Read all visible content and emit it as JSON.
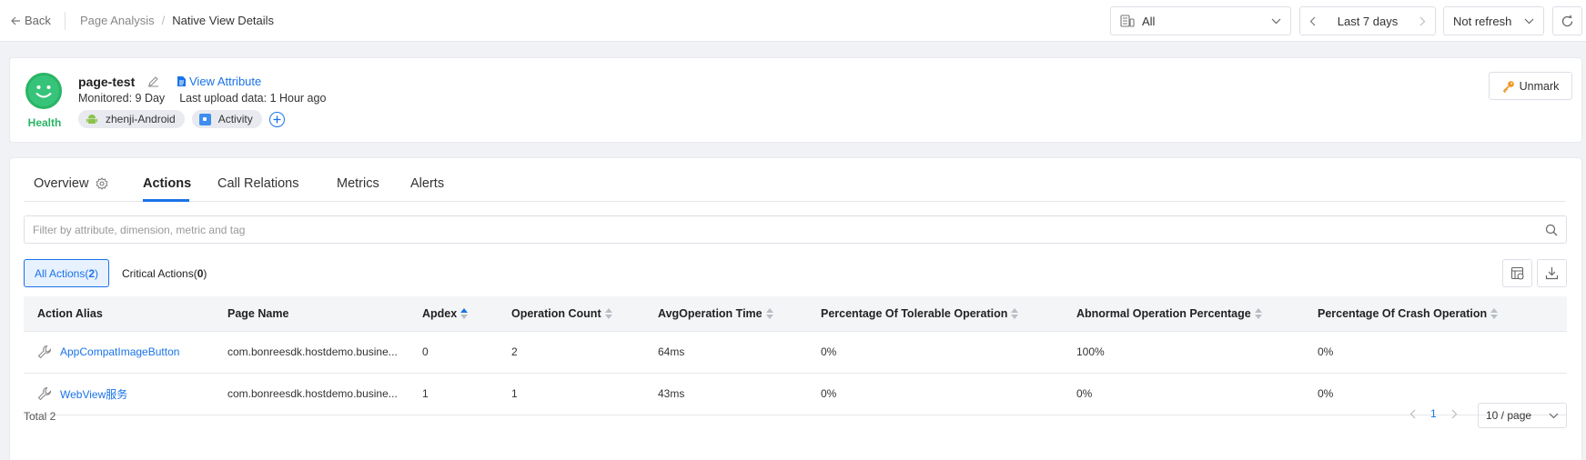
{
  "topbar": {
    "back_label": "Back",
    "breadcrumb": [
      "Page Analysis",
      "Native View Details"
    ],
    "breadcrumb_sep": "/",
    "app_select": "All",
    "time_range": "Last 7 days",
    "refresh": "Not refresh"
  },
  "summary": {
    "title": "page-test",
    "view_attribute": "View Attribute",
    "monitored": "Monitored: 9 Day",
    "last_upload": "Last upload data: 1 Hour ago",
    "health": "Health",
    "tags": [
      {
        "label": "zhenji-Android",
        "icon": "android-icon"
      },
      {
        "label": "Activity",
        "icon": "activity-icon"
      }
    ],
    "unmark_label": "Unmark",
    "colors": {
      "health": "#2ab465",
      "accent": "#1a73e8"
    }
  },
  "tabs": [
    {
      "label": "Overview"
    },
    {
      "label": "Actions",
      "active": true
    },
    {
      "label": "Call Relations"
    },
    {
      "label": "Metrics"
    },
    {
      "label": "Alerts"
    }
  ],
  "search": {
    "placeholder": "Filter by attribute, dimension, metric and tag"
  },
  "filters": {
    "all_label": "All Actions(",
    "all_count": "2",
    "critical_label": "Critical Actions(",
    "critical_count": "0",
    "close": ")"
  },
  "table": {
    "columns": [
      "Action Alias",
      "Page Name",
      "Apdex",
      "Operation Count",
      "AvgOperation Time",
      "Percentage Of Tolerable Operation",
      "Abnormal Operation Percentage",
      "Percentage Of Crash Operation"
    ],
    "rows": [
      [
        "AppCompatImageButton",
        "com.bonreesdk.hostdemo.busine...",
        "0",
        "2",
        "64ms",
        "0%",
        "100%",
        "0%"
      ],
      [
        "WebView服务",
        "com.bonreesdk.hostdemo.busine...",
        "1",
        "1",
        "43ms",
        "0%",
        "0%",
        "0%"
      ]
    ]
  },
  "footer": {
    "total": "Total 2",
    "page": "1",
    "page_size": "10 / page"
  }
}
